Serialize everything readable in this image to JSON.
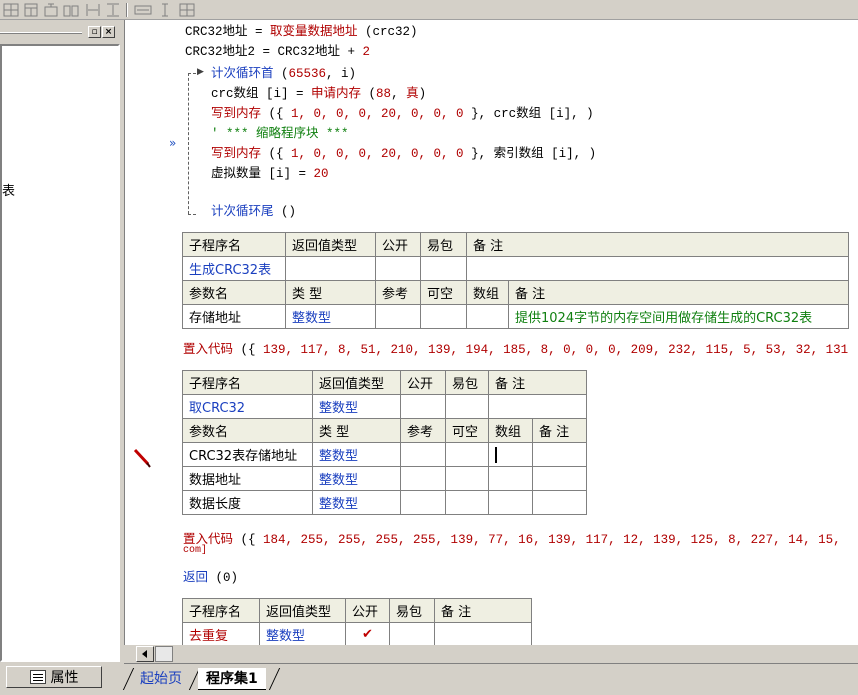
{
  "toolbar": {
    "icons": [
      "grid-icon",
      "table-icon",
      "merge-icon",
      "split-icon",
      "col-width-icon",
      "row-height-icon",
      "fit-width-icon",
      "fit-height-icon",
      "grid-all-icon"
    ]
  },
  "left_panel": {
    "list_fragment": "表"
  },
  "prop_tab": {
    "label": "属性"
  },
  "code": {
    "line1": {
      "a": "CRC32地址 = ",
      "fn": "取变量数据地址",
      "b": " (crc32)"
    },
    "line2": {
      "a": "CRC32地址2 = CRC32地址 + ",
      "num": "2"
    },
    "line3": {
      "a": "计次循环首",
      "b": " (",
      "num": "65536",
      "c": ", i)"
    },
    "line4": {
      "a": "crc数组 [i] = ",
      "fn": "申请内存",
      "b": " (",
      "num": "88",
      "c": ", ",
      "kw": "真",
      "d": ")"
    },
    "line5": {
      "fn": "写到内存",
      "b": " ({ ",
      "nums": "1, 0, 0, 0, 20, 0, 0, 0",
      "c": " }, crc数组 [i], )"
    },
    "line6": {
      "a": "' *** 缩略程序块 ***"
    },
    "line7": {
      "fn": "写到内存",
      "b": " ({ ",
      "nums": "1, 0, 0, 0, 20, 0, 0, 0",
      "c": " }, 索引数组 [i], )"
    },
    "line8": {
      "a": "虚拟数量 [i] = ",
      "num": "20"
    },
    "line9": {
      "a": "计次循环尾",
      "b": " ()"
    },
    "embed1": {
      "fn": "置入代码",
      "b": " ({ ",
      "nums": "139, 117, 8, 51, 210, 139, 194, 185, 8, 0, 0, 0, 209, 232, 115, 5, 53, 32, 131"
    },
    "embed2": {
      "fn": "置入代码",
      "b": " ({ ",
      "nums": "184, 255, 255, 255, 255, 139, 77, 16, 139, 117, 12, 139, 125, 8, 227, 14, 15,",
      "wrap": "com]"
    },
    "return_line": {
      "fn": "返回",
      "b": " (0)"
    },
    "gutter_marker": "»"
  },
  "table1": {
    "header": [
      "子程序名",
      "返回值类型",
      "公开",
      "易包",
      "备 注"
    ],
    "row": [
      "生成CRC32表",
      "",
      "",
      "",
      ""
    ],
    "param_header": [
      "参数名",
      "类 型",
      "参考",
      "可空",
      "数组",
      "备 注"
    ],
    "params": [
      [
        "存储地址",
        "整数型",
        "",
        "",
        "",
        "提供1024字节的内存空间用做存储生成的CRC32表"
      ]
    ]
  },
  "table2": {
    "header": [
      "子程序名",
      "返回值类型",
      "公开",
      "易包",
      "备 注"
    ],
    "row": [
      "取CRC32",
      "整数型",
      "",
      "",
      ""
    ],
    "param_header": [
      "参数名",
      "类 型",
      "参考",
      "可空",
      "数组",
      "备 注"
    ],
    "params": [
      [
        "CRC32表存储地址",
        "整数型",
        "",
        "",
        "",
        ""
      ],
      [
        "数据地址",
        "整数型",
        "",
        "",
        "",
        ""
      ],
      [
        "数据长度",
        "整数型",
        "",
        "",
        "",
        ""
      ]
    ]
  },
  "table3": {
    "header": [
      "子程序名",
      "返回值类型",
      "公开",
      "易包",
      "备 注"
    ],
    "row": [
      "去重复",
      "整数型",
      "✔",
      "",
      ""
    ]
  },
  "tabs": {
    "start": "起始页",
    "active": "程序集1"
  }
}
